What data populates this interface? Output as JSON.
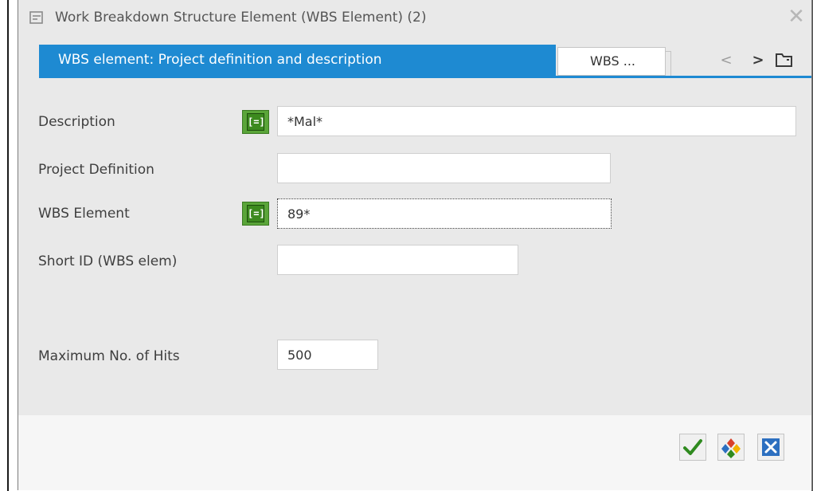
{
  "window": {
    "title": "Work Breakdown Structure Element (WBS Element) (2)",
    "icon": "window-menu-icon",
    "close_icon": "close-icon"
  },
  "tabs": {
    "active_label": "WBS element: Project definition and description",
    "inactive_label": "WBS ...",
    "nav_prev": "<",
    "nav_next": ">",
    "nav_list_icon": "tab-list-icon"
  },
  "fields": {
    "description": {
      "label": "Description",
      "value": "*Mal*",
      "has_options": true
    },
    "project_definition": {
      "label": "Project Definition",
      "value": ""
    },
    "wbs_element": {
      "label": "WBS Element",
      "value": "89*",
      "has_options": true
    },
    "short_id": {
      "label": "Short ID (WBS elem)",
      "value": ""
    },
    "max_hits": {
      "label": "Maximum No. of Hits",
      "value": "500"
    }
  },
  "select_option_symbol": "[=]",
  "footer_buttons": [
    {
      "name": "continue",
      "icon": "checkmark-icon",
      "color": "#2f8a1f"
    },
    {
      "name": "multiple-selection",
      "icon": "multiple-selection-icon",
      "color": "#2c6fc0"
    },
    {
      "name": "cancel",
      "icon": "cancel-icon",
      "color": "#2c6fc0"
    }
  ],
  "colors": {
    "accent": "#1e8ad2",
    "dialog_bg": "#e9e9e9",
    "select_option_green": "#5aa539"
  }
}
